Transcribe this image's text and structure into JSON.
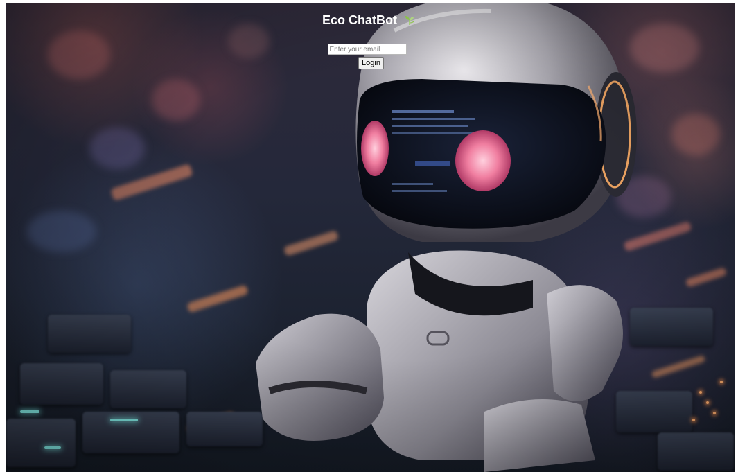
{
  "app": {
    "title": "Eco ChatBot",
    "title_icon": "leaf-sprout-icon",
    "accent_color": "#8bc34a"
  },
  "login": {
    "email_placeholder": "Enter your email",
    "email_value": "",
    "button_label": "Login"
  },
  "background": {
    "image_subject": "robot-illustration"
  }
}
